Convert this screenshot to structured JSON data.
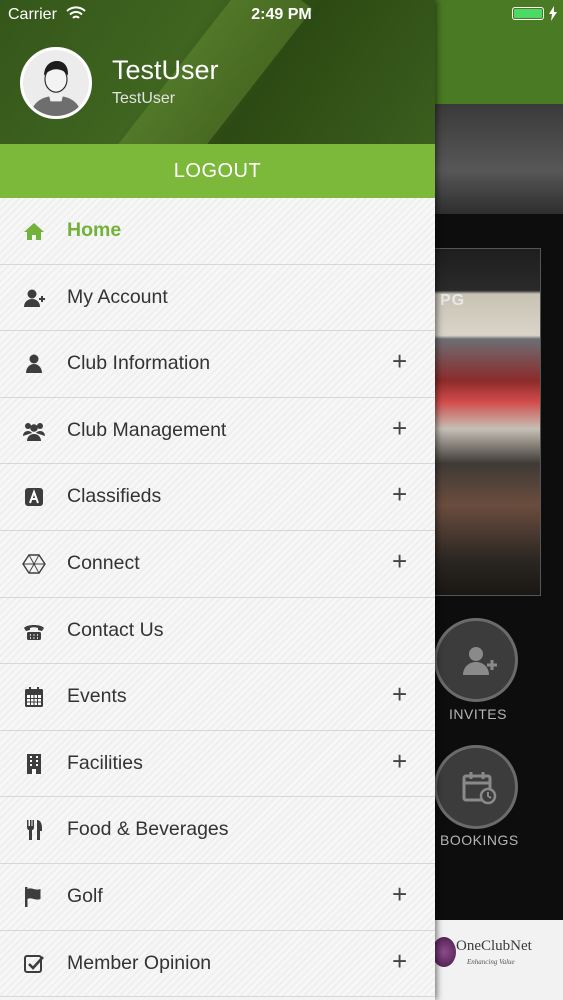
{
  "status_bar": {
    "carrier": "Carrier",
    "time": "2:49 PM"
  },
  "user": {
    "name": "TestUser",
    "subtitle": "TestUser"
  },
  "logout_label": "LOGOUT",
  "menu": [
    {
      "label": "Home",
      "icon": "home-icon",
      "expandable": false,
      "active": true
    },
    {
      "label": "My Account",
      "icon": "user-plus-icon",
      "expandable": false
    },
    {
      "label": "Club Information",
      "icon": "person-icon",
      "expandable": true
    },
    {
      "label": "Club Management",
      "icon": "users-icon",
      "expandable": true
    },
    {
      "label": "Classifieds",
      "icon": "classifieds-icon",
      "expandable": true
    },
    {
      "label": "Connect",
      "icon": "hexagon-icon",
      "expandable": true
    },
    {
      "label": "Contact Us",
      "icon": "phone-icon",
      "expandable": false
    },
    {
      "label": "Events",
      "icon": "calendar-icon",
      "expandable": true
    },
    {
      "label": "Facilities",
      "icon": "building-icon",
      "expandable": true
    },
    {
      "label": "Food & Beverages",
      "icon": "cutlery-icon",
      "expandable": false
    },
    {
      "label": "Golf",
      "icon": "flag-icon",
      "expandable": true
    },
    {
      "label": "Member Opinion",
      "icon": "checkbox-icon",
      "expandable": true
    }
  ],
  "plus_symbol": "+",
  "background": {
    "photo_label": "PG",
    "actions": [
      {
        "label": "INVITES"
      },
      {
        "label": "BOOKINGS"
      }
    ],
    "logo_text": "OneClubNet",
    "logo_tagline": "Enhancing Value"
  },
  "colors": {
    "accent_green": "#7cb83a",
    "header_green": "#3f6520",
    "active_label": "#73b23a"
  }
}
